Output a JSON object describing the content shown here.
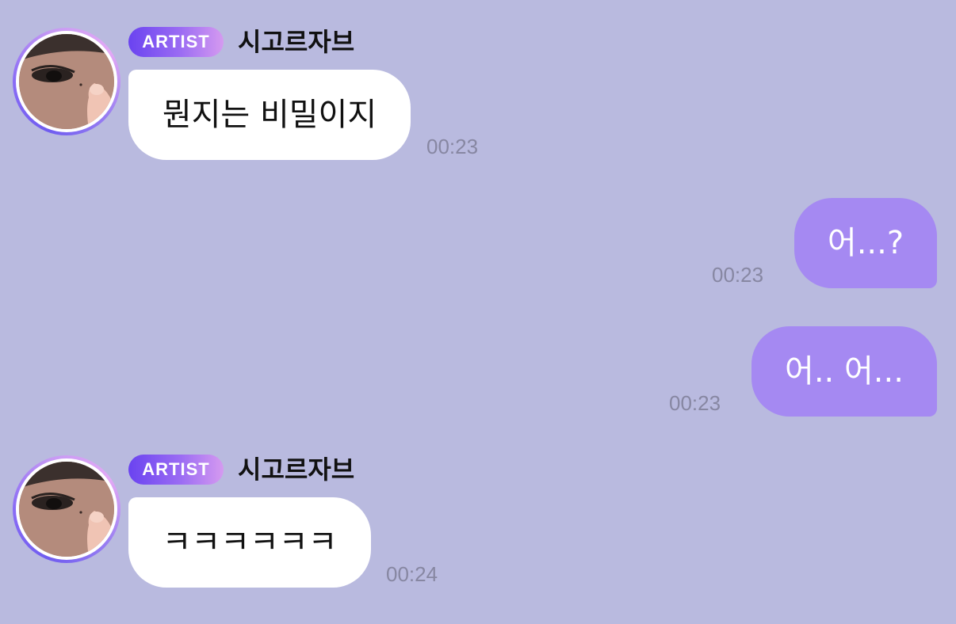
{
  "theme": {
    "background": "#b9badf",
    "incoming_bubble": "#ffffff",
    "outgoing_bubble": "#a589f2",
    "badge_gradient": [
      "#6a43f0",
      "#d59af0"
    ]
  },
  "messages": [
    {
      "direction": "incoming",
      "badge": "ARTIST",
      "sender": "시고르자브",
      "avatar": "artist-avatar",
      "text": "뭔지는 비밀이지",
      "time": "00:23"
    },
    {
      "direction": "outgoing",
      "text": "어...?",
      "time": "00:23"
    },
    {
      "direction": "outgoing",
      "text": "어.. 어...",
      "time": "00:23"
    },
    {
      "direction": "incoming",
      "badge": "ARTIST",
      "sender": "시고르자브",
      "avatar": "artist-avatar",
      "text": "ㅋㅋㅋㅋㅋㅋ",
      "time": "00:24"
    }
  ]
}
